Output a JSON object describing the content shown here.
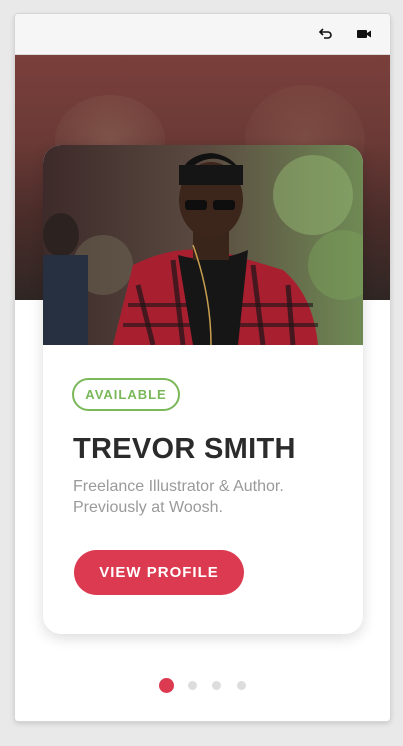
{
  "toolbar": {
    "back_icon": "undo-arrow-icon",
    "camera_icon": "video-camera-icon"
  },
  "profile": {
    "status": "AVAILABLE",
    "name": "TREVOR SMITH",
    "bio": "Freelance Illustrator & Author. Previously at Woosh.",
    "cta": "VIEW PROFILE"
  },
  "pagination": {
    "total": 4,
    "active_index": 0
  },
  "colors": {
    "accent": "#dc3a50",
    "available": "#7ab85a"
  }
}
